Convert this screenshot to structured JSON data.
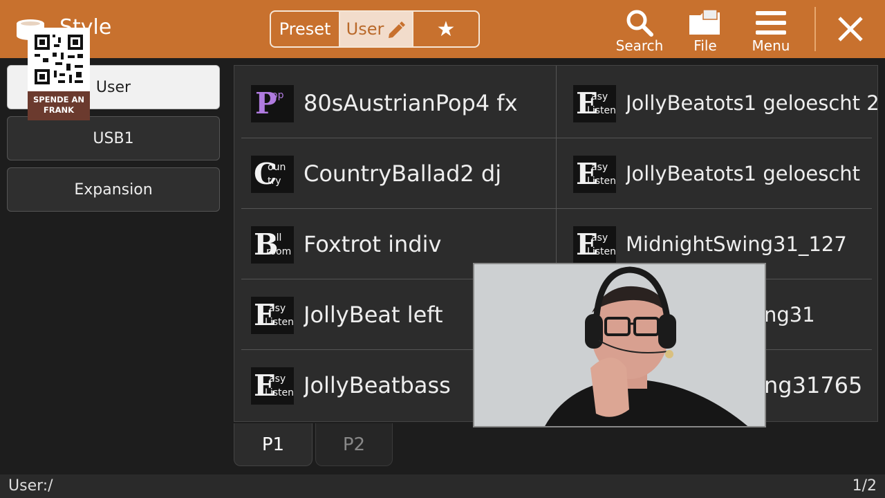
{
  "app": {
    "title": "Style"
  },
  "donate": {
    "caption": "SPENDE AN FRANK"
  },
  "source_tabs": [
    "Preset",
    "User",
    "★"
  ],
  "toolbar": {
    "search": "Search",
    "file": "File",
    "menu": "Menu"
  },
  "colors": {
    "accent": "#c8712e",
    "selected_tab": "#f2dccb",
    "pop_badge": "#b07be0"
  },
  "sidebar": {
    "items": [
      "User",
      "USB1",
      "Expansion"
    ],
    "selected": "User"
  },
  "styles": [
    {
      "name": "80sAustrianPop4 fx",
      "category": "Pop",
      "badge": {
        "big": "P",
        "top": "op",
        "bottom": ""
      }
    },
    {
      "name": "JollyBeatots1 geloescht 2",
      "category": "Easy Listen",
      "badge": {
        "big": "E",
        "top": "asy",
        "bottom": "Listen"
      }
    },
    {
      "name": "CountryBallad2 dj",
      "category": "Country",
      "badge": {
        "big": "C",
        "top": "oun",
        "bottom": "try"
      }
    },
    {
      "name": "JollyBeatots1 geloescht",
      "category": "Easy Listen",
      "badge": {
        "big": "E",
        "top": "asy",
        "bottom": "Listen"
      }
    },
    {
      "name": "Foxtrot indiv",
      "category": "Ballroom",
      "badge": {
        "big": "B",
        "top": "all",
        "bottom": "room"
      }
    },
    {
      "name": "MidnightSwing31_127",
      "category": "Easy Listen",
      "badge": {
        "big": "E",
        "top": "asy",
        "bottom": "Listen"
      }
    },
    {
      "name": "JollyBeat left",
      "category": "Easy Listen",
      "badge": {
        "big": "E",
        "top": "asy",
        "bottom": "Listen"
      }
    },
    {
      "name": "ng31",
      "category": "",
      "badge": null
    },
    {
      "name": "JollyBeatbass",
      "category": "Easy Listen",
      "badge": {
        "big": "E",
        "top": "asy",
        "bottom": "Listen"
      }
    },
    {
      "name": "ng31765",
      "category": "",
      "badge": null
    }
  ],
  "page_tabs": [
    "P1",
    "P2"
  ],
  "status": {
    "path": "User:/",
    "page": "1/2"
  }
}
